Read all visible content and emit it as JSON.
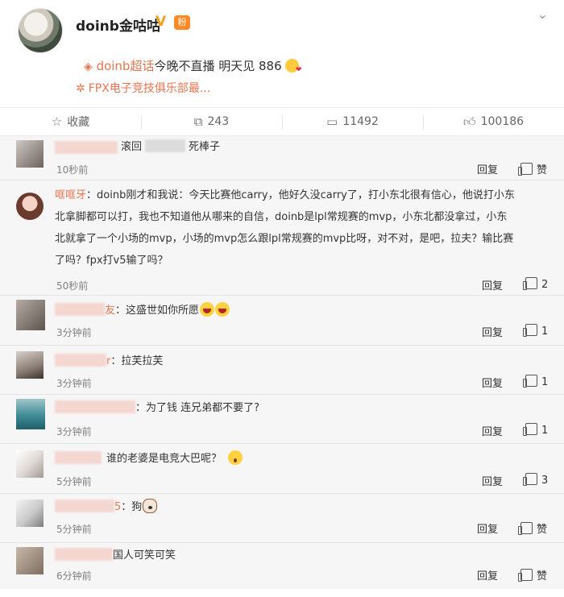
{
  "post": {
    "author": "doinb金咕咕",
    "vip_mark": "V",
    "fans_badge": "粉",
    "topic": "doinb超话",
    "content": "今晚不直播 明天见 886",
    "source": "FPX电子竞技俱乐部最..."
  },
  "actions": {
    "favorite": "收藏",
    "repost": "243",
    "comment": "11492",
    "like": "100186"
  },
  "comments": [
    {
      "name": "",
      "text": "滚回",
      "text2": "死棒子",
      "time": "10秒前",
      "reply": "回复",
      "like": "赞"
    },
    {
      "name": "哐哐牙",
      "text_lines": [
        "：doinb刚才和我说：今天比赛他carry，他好久没carry了，打小东北很有信心，他说打小东",
        "北拿脚都可以打，我也不知道他从哪来的自信，doinb是lpl常规赛的mvp，小东北都没拿过，小东",
        "北就拿了一个小场的mvp，小场的mvp怎么跟lpl常规赛的mvp比呀，对不对，是吧，拉夫？输比赛",
        "了吗？fpx打v5输了吗？"
      ],
      "time": "50秒前",
      "reply": "回复",
      "like": "2"
    },
    {
      "name_tail": "友",
      "text": "：这盛世如你所愿",
      "time": "3分钟前",
      "reply": "回复",
      "like": "1"
    },
    {
      "name_tail": "r",
      "text": "：拉芙拉芙",
      "time": "3分钟前",
      "reply": "回复",
      "like": "1"
    },
    {
      "name_tail": "",
      "text": "：为了钱 连兄弟都不要了?",
      "time": "3分钟前",
      "reply": "回复",
      "like": "1"
    },
    {
      "name_tail": "",
      "text": "谁的老婆是电竞大巴呢？",
      "time": "5分钟前",
      "reply": "回复",
      "like": "3"
    },
    {
      "name_tail": "5",
      "text": "：狗",
      "time": "5分钟前",
      "reply": "回复",
      "like": "赞"
    },
    {
      "name_tail": "",
      "text": "国人可笑可笑",
      "time": "6分钟前",
      "reply": "回复",
      "like": "赞"
    }
  ]
}
